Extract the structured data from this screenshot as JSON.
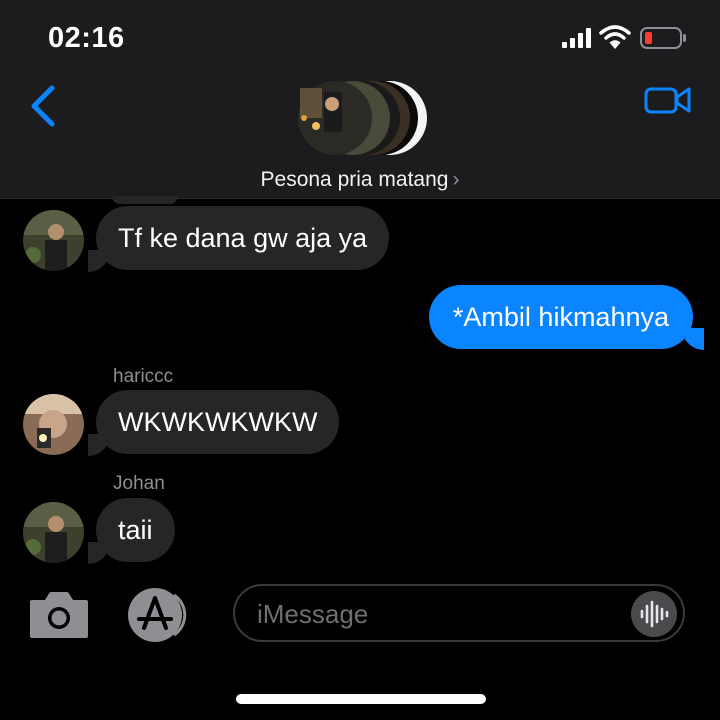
{
  "status_bar": {
    "time": "02:16",
    "battery_color": "#ff3b30"
  },
  "header": {
    "group_name": "Pesona pria matang",
    "chevron": "›",
    "icons": {
      "back": "chevron-left-icon",
      "video": "video-camera-icon"
    }
  },
  "messages": [
    {
      "direction": "incoming",
      "sender_label": "",
      "text": "Tf ke dana gw aja ya",
      "avatar": "johan-avatar"
    },
    {
      "direction": "outgoing",
      "text": "*Ambil hikmahnya"
    },
    {
      "direction": "incoming",
      "sender_label": "hariccc",
      "text": "WKWKWKWKW",
      "avatar": "hariccc-avatar"
    },
    {
      "direction": "incoming",
      "sender_label": "Johan",
      "text": "taii",
      "avatar": "johan-avatar"
    }
  ],
  "input_bar": {
    "placeholder": "iMessage",
    "icons": {
      "camera": "camera-icon",
      "apps": "app-store-icon",
      "audio": "audio-waveform-icon"
    }
  },
  "colors": {
    "accent": "#0a84ff",
    "incoming_bubble": "#262628",
    "header_bg": "#1c1c1e"
  }
}
